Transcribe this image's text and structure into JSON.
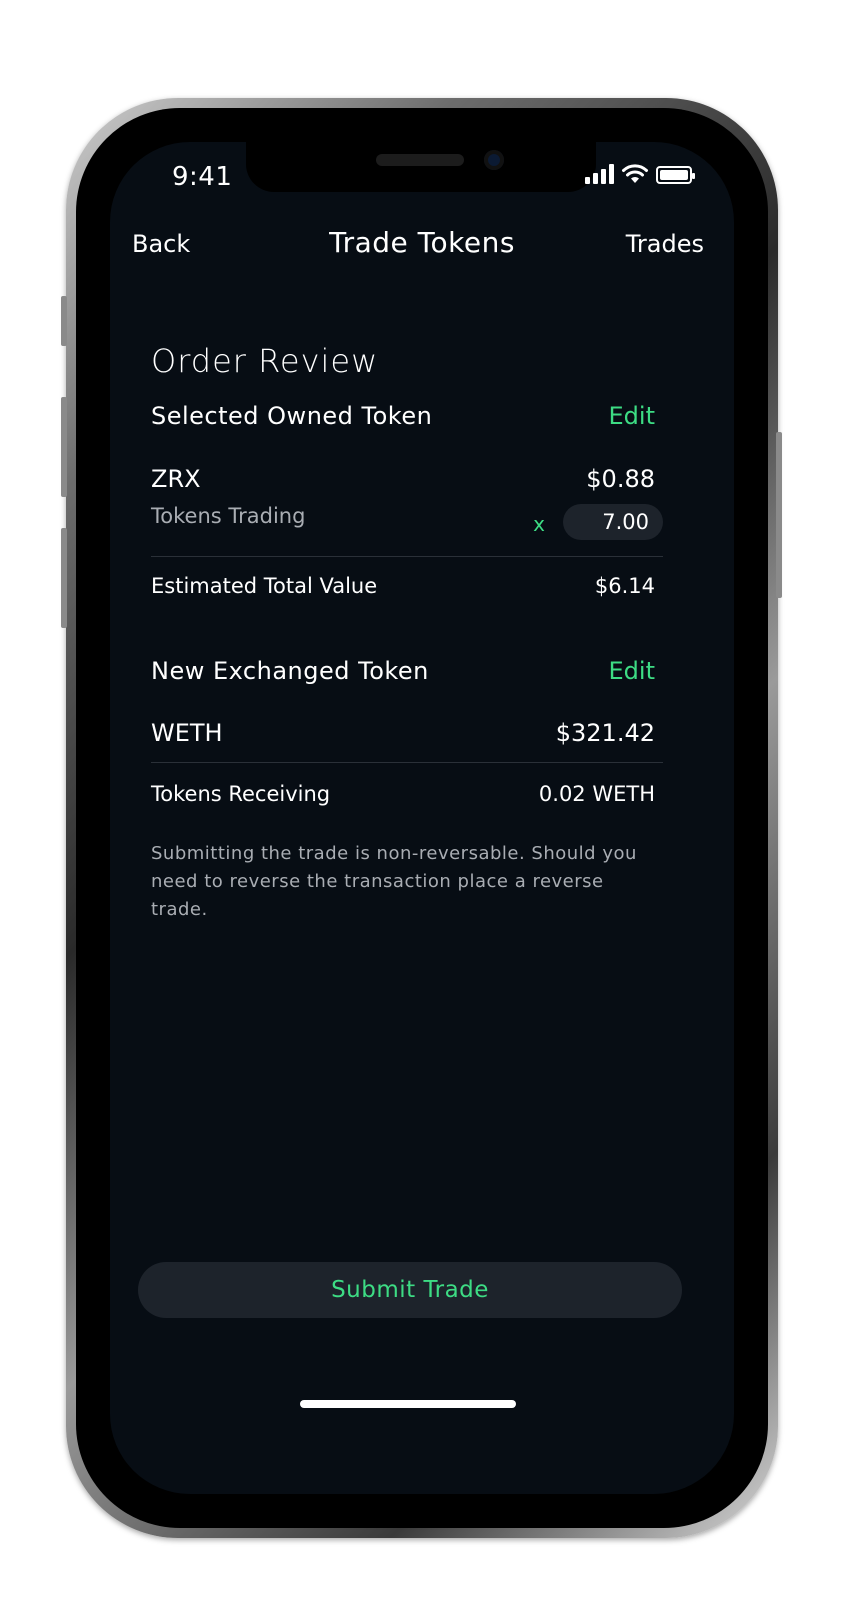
{
  "status_bar": {
    "time": "9:41"
  },
  "nav": {
    "back_label": "Back",
    "title": "Trade Tokens",
    "trades_label": "Trades"
  },
  "order": {
    "heading": "Order Review",
    "owned": {
      "section_label": "Selected Owned Token",
      "edit_label": "Edit",
      "token": "ZRX",
      "price": "$0.88",
      "trading_label": "Tokens Trading",
      "multiplier": "x",
      "quantity": "7.00"
    },
    "estimated": {
      "label": "Estimated Total Value",
      "value": "$6.14"
    },
    "exchanged": {
      "section_label": "New Exchanged Token",
      "edit_label": "Edit",
      "token": "WETH",
      "price": "$321.42"
    },
    "receiving": {
      "label": "Tokens Receiving",
      "value": "0.02 WETH"
    },
    "disclaimer": "Submitting the trade is non-reversable. Should you need to reverse the transaction place a reverse trade."
  },
  "actions": {
    "submit_label": "Submit Trade"
  },
  "colors": {
    "accent": "#3ddc84",
    "background": "#070d14",
    "surface": "#1d232b"
  },
  "icons": [
    "signal-icon",
    "wifi-icon",
    "battery-icon"
  ]
}
